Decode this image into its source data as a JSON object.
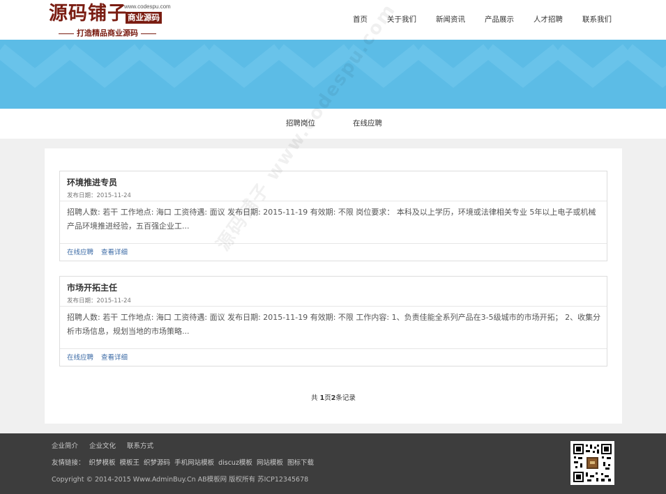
{
  "logo": {
    "main": "源码铺子",
    "url": "www.codespu.com",
    "badge": "商业源码",
    "slogan": "打造精品商业源码"
  },
  "nav": {
    "items": [
      "首页",
      "关于我们",
      "新闻资讯",
      "产品展示",
      "人才招聘",
      "联系我们"
    ]
  },
  "subnav": {
    "items": [
      "招聘岗位",
      "在线应聘"
    ]
  },
  "jobs": [
    {
      "title": "环境推进专员",
      "date": "发布日期：2015-11-24",
      "desc": "招聘人数: 若干 工作地点: 海口 工资待遇: 面议 发布日期: 2015-11-19 有效期: 不限 岗位要求： 本科及以上学历，环境或法律相关专业 5年以上电子或机械产品环境推进经验，五百强企业工...",
      "apply": "在线应聘",
      "details": "查看详细"
    },
    {
      "title": "市场开拓主任",
      "date": "发布日期：2015-11-24",
      "desc": "招聘人数: 若干 工作地点: 海口 工资待遇: 面议 发布日期: 2015-11-19 有效期: 不限 工作内容: 1、负责佳能全系列产品在3-5级城市的市场开拓； 2、收集分析市场信息，规划当地的市场策略...",
      "apply": "在线应聘",
      "details": "查看详细"
    }
  ],
  "pager": {
    "prefix": "共 ",
    "pages": "1",
    "mid": "页",
    "records": "2",
    "suffix": "条记录"
  },
  "watermark": "源码铺子 www.codespu.com",
  "footer": {
    "links": [
      "企业简介",
      "企业文化",
      "联系方式"
    ],
    "friend_label": "友情链接：",
    "friend_links": [
      "织梦模板",
      "模板王",
      "织梦源码",
      "手机网站模板",
      "discuz模板",
      "网站模板",
      "图标下载"
    ],
    "copyright": "Copyright © 2014-2015 Www.AdminBuy.Cn AB模板网 版权所有    苏ICP12345678"
  },
  "colors": {
    "brand": "#7a1d12",
    "banner": "#5cbce6",
    "link": "#3b6aa5",
    "footer": "#3d3d3d"
  }
}
